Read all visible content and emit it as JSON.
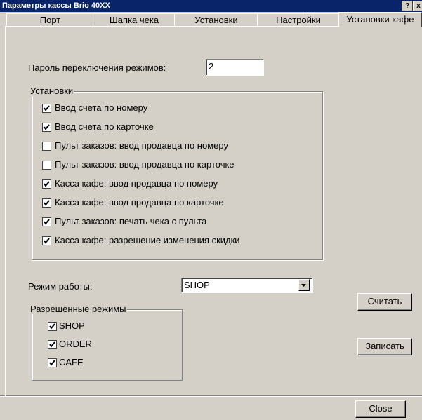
{
  "window": {
    "title": "Параметры кассы Brio 40XX",
    "help_label": "?",
    "close_label": "x"
  },
  "tabs": [
    {
      "label": "Порт"
    },
    {
      "label": "Шапка чека"
    },
    {
      "label": "Установки"
    },
    {
      "label": "Настройки"
    },
    {
      "label": "Установки кафе",
      "active": true
    }
  ],
  "password": {
    "label": "Пароль переключения режимов:",
    "value": "2"
  },
  "settings": {
    "title": "Установки",
    "items": [
      {
        "label": "Ввод счета по номеру",
        "checked": true
      },
      {
        "label": "Ввод счета по карточке",
        "checked": true
      },
      {
        "label": "Пульт заказов: ввод продавца по номеру",
        "checked": false
      },
      {
        "label": "Пульт заказов: ввод продавца по карточке",
        "checked": false
      },
      {
        "label": "Касса кафе: ввод продавца по номеру",
        "checked": true
      },
      {
        "label": "Касса кафе: ввод продавца по карточке",
        "checked": true
      },
      {
        "label": "Пульт заказов: печать чека с пульта",
        "checked": true
      },
      {
        "label": "Касса кафе: разрешение изменения скидки",
        "checked": true
      }
    ]
  },
  "mode": {
    "label": "Режим работы:",
    "value": "SHOP"
  },
  "allowed_modes": {
    "title": "Разрешенные режимы",
    "items": [
      {
        "label": "SHOP",
        "checked": true
      },
      {
        "label": "ORDER",
        "checked": true
      },
      {
        "label": "CAFE",
        "checked": true
      }
    ]
  },
  "buttons": {
    "read": "Считать",
    "write": "Записать",
    "close": "Close"
  }
}
